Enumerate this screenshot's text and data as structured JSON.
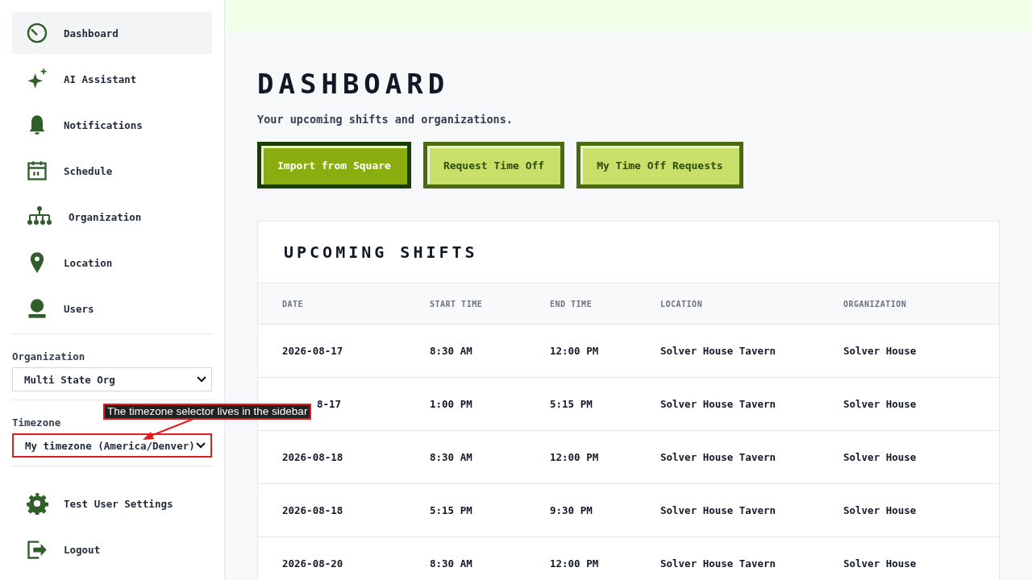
{
  "sidebar": {
    "items": [
      {
        "label": "Dashboard",
        "kind": "dashboard",
        "selected": true
      },
      {
        "label": "AI Assistant",
        "kind": "assistant",
        "selected": false
      },
      {
        "label": "Notifications",
        "kind": "notifications",
        "selected": false
      },
      {
        "label": "Schedule",
        "kind": "schedule",
        "selected": false
      },
      {
        "label": "Organization",
        "kind": "organization",
        "selected": false
      },
      {
        "label": "Location",
        "kind": "location",
        "selected": false
      },
      {
        "label": "Users",
        "kind": "users",
        "selected": false
      }
    ],
    "selectors": [
      {
        "label": "Organization",
        "value": "Multi State Org",
        "highlighted": false
      },
      {
        "label": "Timezone",
        "value": "My timezone (America/Denver)",
        "highlighted": true
      }
    ],
    "bottom_items": [
      {
        "label": "Test User Settings",
        "kind": "settings"
      },
      {
        "label": "Logout",
        "kind": "logout"
      }
    ]
  },
  "callout": {
    "text": "The timezone selector lives in the sidebar"
  },
  "page": {
    "title": "DASHBOARD",
    "subtitle": "Your upcoming shifts and organizations.",
    "buttons": [
      {
        "label": "Import from Square",
        "kind": "primary"
      },
      {
        "label": "Request Time Off",
        "kind": "secondary"
      },
      {
        "label": "My Time Off Requests",
        "kind": "secondary"
      }
    ]
  },
  "shifts": {
    "title": "UPCOMING SHIFTS",
    "columns": [
      "DATE",
      "START TIME",
      "END TIME",
      "LOCATION",
      "ORGANIZATION"
    ],
    "rows": [
      [
        "2026-08-17",
        "8:30 AM",
        "12:00 PM",
        "Solver House Tavern",
        "Solver House"
      ],
      [
        "8-17",
        "1:00 PM",
        "5:15 PM",
        "Solver House Tavern",
        "Solver House"
      ],
      [
        "2026-08-18",
        "8:30 AM",
        "12:00 PM",
        "Solver House Tavern",
        "Solver House"
      ],
      [
        "2026-08-18",
        "5:15 PM",
        "9:30 PM",
        "Solver House Tavern",
        "Solver House"
      ],
      [
        "2026-08-20",
        "8:30 AM",
        "12:00 PM",
        "Solver House Tavern",
        "Solver House"
      ]
    ]
  }
}
